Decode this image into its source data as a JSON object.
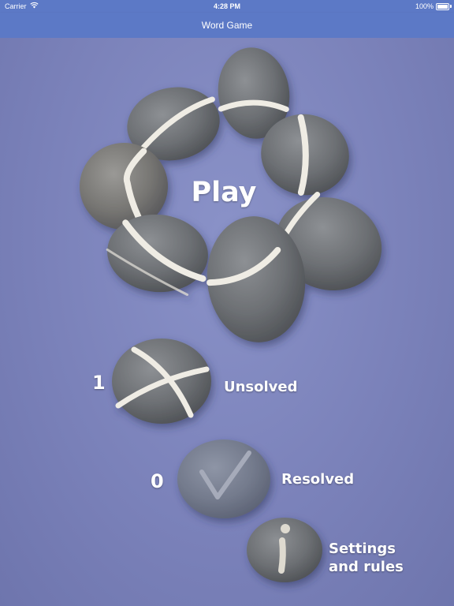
{
  "status_bar": {
    "carrier": "Carrier",
    "wifi_icon": "wifi-icon",
    "time": "4:28 PM",
    "battery_percent": "100%",
    "battery_icon": "battery-icon"
  },
  "nav": {
    "title": "Word Game"
  },
  "play": {
    "label": "Play"
  },
  "unsolved": {
    "count": "1",
    "label": "Unsolved"
  },
  "resolved": {
    "count": "0",
    "label": "Resolved"
  },
  "settings": {
    "label_line1": "Settings",
    "label_line2": "and rules"
  },
  "colors": {
    "bar": "#5c79c6",
    "background": "#7b82ba",
    "stone": "#6f7276",
    "stone_vein": "#efece4",
    "text": "#ffffff"
  }
}
